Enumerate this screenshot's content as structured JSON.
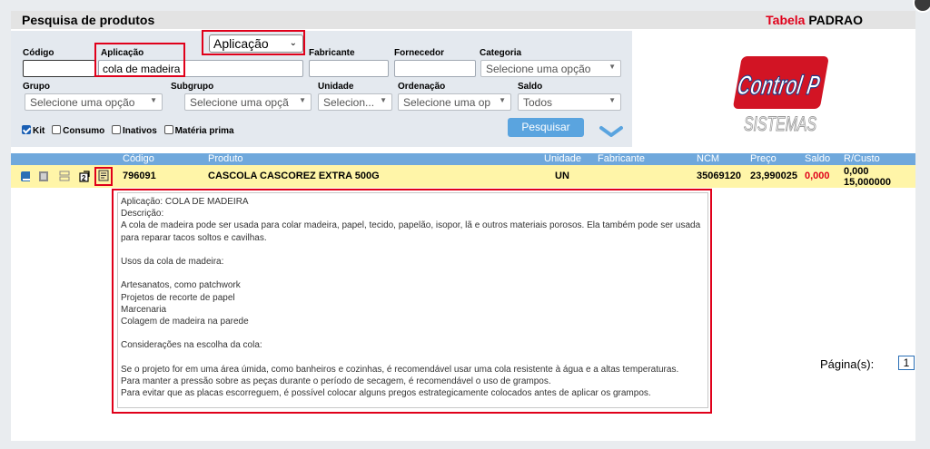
{
  "header": {
    "title": "Pesquisa de produtos",
    "tabela_label": "Tabela",
    "tabela_value": "PADRAO"
  },
  "filters": {
    "codigo_label": "Código",
    "codigo_value": "",
    "aplicacao_label": "Aplicação",
    "aplicacao_value": "cola de madeira",
    "search_mode": "Aplicação",
    "fabricante_label": "Fabricante",
    "fabricante_value": "",
    "fornecedor_label": "Fornecedor",
    "fornecedor_value": "",
    "categoria_label": "Categoria",
    "categoria_value": "Selecione uma opção",
    "grupo_label": "Grupo",
    "grupo_value": "Selecione uma opção",
    "subgrupo_label": "Subgrupo",
    "subgrupo_value": "Selecione uma opção",
    "unidade_label": "Unidade",
    "unidade_value": "Selecion...",
    "ordenacao_label": "Ordenação",
    "ordenacao_value": "Selecione uma op...",
    "saldo_label": "Saldo",
    "saldo_value": "Todos",
    "checkboxes": [
      {
        "label": "Kit",
        "checked": true
      },
      {
        "label": "Consumo",
        "checked": false
      },
      {
        "label": "Inativos",
        "checked": false
      },
      {
        "label": "Matéria prima",
        "checked": false
      }
    ],
    "search_button": "Pesquisar"
  },
  "logo": {
    "line1": "Control P",
    "line2": "SISTEMAS"
  },
  "grid": {
    "columns": [
      "Código",
      "Produto",
      "Unidade",
      "Fabricante",
      "NCM",
      "Preço",
      "Saldo",
      "R/Custo"
    ],
    "row": {
      "codigo": "796091",
      "produto": "CASCOLA CASCOREZ EXTRA 500G",
      "unidade": "UN",
      "fabricante": "",
      "ncm": "35069120",
      "preco": "23,990025",
      "saldo": "0,000",
      "rcusto_1": "0,000",
      "rcusto_2": "15,000000"
    },
    "saldo_color": "#e0001a",
    "header_color": "#6fa8dc",
    "row_color": "#fff5a8"
  },
  "detail": {
    "lines": [
      "Aplicação: COLA DE MADEIRA",
      "Descrição:",
      "A cola de madeira pode ser usada para colar madeira, papel, tecido, papelão, isopor, lã e outros materiais porosos. Ela também pode ser usada",
      "para reparar tacos soltos e cavilhas.",
      "",
      "Usos da cola de madeira:",
      "",
      "Artesanatos, como patchwork",
      "Projetos de recorte de papel",
      "Marcenaria",
      "Colagem de madeira na parede",
      "",
      "Considerações na escolha da cola:",
      "",
      "Se o projeto for em uma área úmida, como banheiros e cozinhas, é recomendável usar uma cola resistente à água e a altas temperaturas.",
      "Para manter a pressão sobre as peças durante o período de secagem, é recomendável o uso de grampos.",
      "Para evitar que as placas escorreguem, é possível colocar alguns pregos estrategicamente colocados antes de aplicar os grampos."
    ]
  },
  "pager": {
    "label": "Página(s):",
    "current": "1"
  },
  "colors": {
    "highlight": "#e0001a",
    "button": "#5aa4df",
    "filter_bg": "#e4e9ef"
  }
}
